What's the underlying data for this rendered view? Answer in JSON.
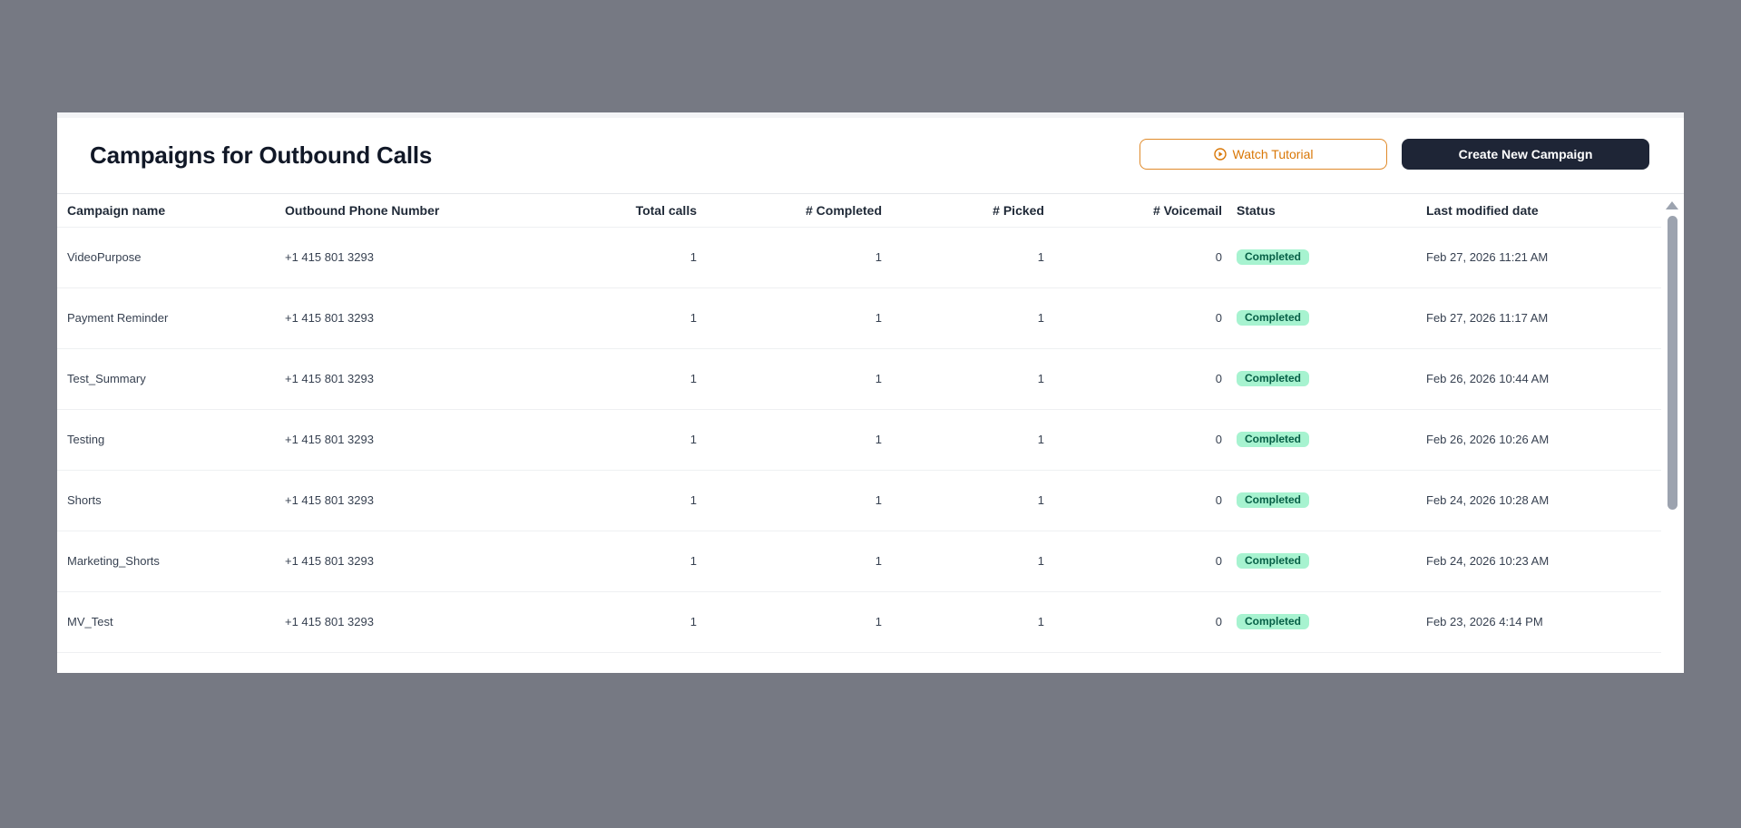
{
  "header": {
    "title": "Campaigns for Outbound Calls",
    "watch_tutorial_label": "Watch Tutorial",
    "watch_tutorial_icon": "play-circle-icon",
    "create_label": "Create New Campaign"
  },
  "colors": {
    "accent_orange": "#d97706",
    "primary_dark": "#1e2536",
    "status_completed_bg": "#a7f3d0",
    "status_completed_text": "#065f46"
  },
  "table": {
    "columns": [
      "Campaign name",
      "Outbound Phone Number",
      "Total calls",
      "# Completed",
      "# Picked",
      "# Voicemail",
      "Status",
      "Last modified date"
    ],
    "rows": [
      {
        "name": "VideoPurpose",
        "phone": "+1 415 801 3293",
        "total": "1",
        "completed": "1",
        "picked": "1",
        "voicemail": "0",
        "status": "Completed",
        "date": "Feb 27, 2026 11:21 AM"
      },
      {
        "name": "Payment Reminder",
        "phone": "+1 415 801 3293",
        "total": "1",
        "completed": "1",
        "picked": "1",
        "voicemail": "0",
        "status": "Completed",
        "date": "Feb 27, 2026 11:17 AM"
      },
      {
        "name": "Test_Summary",
        "phone": "+1 415 801 3293",
        "total": "1",
        "completed": "1",
        "picked": "1",
        "voicemail": "0",
        "status": "Completed",
        "date": "Feb 26, 2026 10:44 AM"
      },
      {
        "name": "Testing",
        "phone": "+1 415 801 3293",
        "total": "1",
        "completed": "1",
        "picked": "1",
        "voicemail": "0",
        "status": "Completed",
        "date": "Feb 26, 2026 10:26 AM"
      },
      {
        "name": "Shorts",
        "phone": "+1 415 801 3293",
        "total": "1",
        "completed": "1",
        "picked": "1",
        "voicemail": "0",
        "status": "Completed",
        "date": "Feb 24, 2026 10:28 AM"
      },
      {
        "name": "Marketing_Shorts",
        "phone": "+1 415 801 3293",
        "total": "1",
        "completed": "1",
        "picked": "1",
        "voicemail": "0",
        "status": "Completed",
        "date": "Feb 24, 2026 10:23 AM"
      },
      {
        "name": "MV_Test",
        "phone": "+1 415 801 3293",
        "total": "1",
        "completed": "1",
        "picked": "1",
        "voicemail": "0",
        "status": "Completed",
        "date": "Feb 23, 2026 4:14 PM"
      }
    ]
  }
}
